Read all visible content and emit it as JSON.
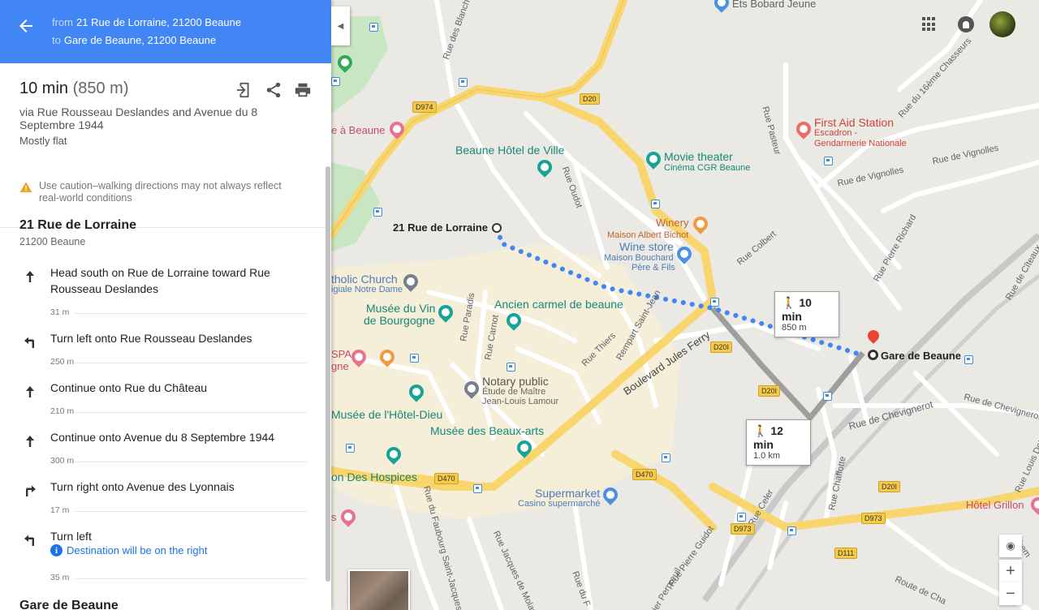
{
  "header": {
    "from_prefix": "from",
    "from_address": "21 Rue de Lorraine, 21200 Beaune",
    "to_prefix": "to",
    "to_address": "Gare de Beaune, 21200 Beaune"
  },
  "summary": {
    "time": "10 min",
    "distance": "(850 m)",
    "via": "via Rue Rousseau Deslandes and Avenue du 8 Septembre 1944",
    "terrain": "Mostly flat",
    "icons": [
      "send-to-phone-icon",
      "share-icon",
      "print-icon"
    ]
  },
  "caution": "Use caution–walking directions may not always reflect real-world conditions",
  "origin": {
    "title": "21 Rue de Lorraine",
    "subtitle": "21200 Beaune"
  },
  "steps": [
    {
      "icon": "arrow-straight-icon",
      "text": "Head south on Rue de Lorraine toward Rue Rousseau Deslandes",
      "distance": "31 m"
    },
    {
      "icon": "turn-left-icon",
      "text": "Turn left onto Rue Rousseau Deslandes",
      "distance": "250 m"
    },
    {
      "icon": "arrow-straight-icon",
      "text": "Continue onto Rue du Château",
      "distance": "210 m"
    },
    {
      "icon": "arrow-straight-icon",
      "text": "Continue onto Avenue du 8 Septembre 1944",
      "distance": "300 m"
    },
    {
      "icon": "turn-right-icon",
      "text": "Turn right onto Avenue des Lyonnais",
      "distance": "17 m"
    },
    {
      "icon": "turn-left-icon",
      "text": "Turn left",
      "info": "Destination will be on the right",
      "distance": "35 m"
    }
  ],
  "destination": {
    "title": "Gare de Beaune"
  },
  "map": {
    "labels": {
      "ets_bobard": "Ets Bobard Jeune",
      "first_aid": "First Aid Station",
      "first_aid_sub1": "Escadron -",
      "first_aid_sub2": "Gendarmerie Nationale",
      "beaune_hotel_de_ville": "Beaune Hôtel de Ville",
      "movie_theater": "Movie theater",
      "cinema": "Cinéma CGR Beaune",
      "winery": "Winery",
      "winery_sub": "Maison Albert Bichot",
      "wine_store": "Wine store",
      "wine_store_sub1": "Maison Bouchard",
      "wine_store_sub2": "Père & Fils",
      "origin_label": "21 Rue de Lorraine",
      "dest_label": "Gare de Beaune",
      "catholic_church": "tholic Church",
      "catholic_sub": "igiale Notre Dame",
      "musee_du_vin_1": "Musée du Vin",
      "musee_du_vin_2": "de Bourgogne",
      "ancien_carmel": "Ancien carmel de beaune",
      "notary": "Notary public",
      "notary_sub1": "Étude de Maître",
      "notary_sub2": "Jean-Louis Lamour",
      "musee_hotel_dieu": "Musée de l'Hôtel-Dieu",
      "musee_beaux_arts": "Musée des Beaux-arts",
      "des_hospices": "on Des Hospices",
      "supermarket": "Supermarket",
      "supermarket_sub": "Casino supermarché",
      "hotel_grillon": "Hôtel Grillon",
      "spa_1": "SPA",
      "spa_2": "gne",
      "a_beaune": "e à Beaune",
      "s_label": "s"
    },
    "streets": {
      "rue_pasteur": "Rue Pasteur",
      "rue_colbert": "Rue Colbert",
      "rue_de_vignolles": "Rue de Vignolles",
      "rue_de_vignolles2": "Rue de Vignolles",
      "rue_du_16eme": "Rue du 16ème Chasseurs",
      "rue_pierre_richard": "Rue Pierre Richard",
      "rue_de_citeaux": "Rue de Cîteaux",
      "boulevard_jules_ferry": "Boulevard Jules Ferry",
      "rue_de_chevignerot": "Rue de Chevignerot",
      "rue_de_chevignerot2": "Rue de Chevignerot",
      "rue_chaffotte": "Rue Chaffotte",
      "rue_celer": "Rue Celer",
      "rue_louis_dettling": "Rue Louis Dettling",
      "rue_pierre_guidot": "Rue Pierre Guidot",
      "rue_perpreuil": "atier Perpreuil",
      "rue_jacques_de_molay": "Rue Jacques de Molay",
      "rue_faubourg": "Rue du Faubourg Saint-Jacques",
      "rue_thiers": "Rue Thiers",
      "rempart_saint_jean": "Rempart Saint-Jean",
      "rue_carnot": "Rue Carnot",
      "rue_paradis": "Rue Paradis",
      "rue_oudot": "Rue Oudot",
      "rue_des_blanches": "Rue des Blanches",
      "route_de_chalon": "Route de Cha",
      "chemin": "Chem",
      "rue_b": "Rue du F"
    },
    "shields": [
      "D974",
      "D20",
      "D20I",
      "D20I",
      "D470",
      "D470",
      "D973",
      "D973",
      "D111",
      "D20I"
    ],
    "route_primary": {
      "time": "10 min",
      "distance": "850 m"
    },
    "route_alt": {
      "time": "12 min",
      "distance": "1.0 km"
    },
    "controls": {
      "zoom_in": "+",
      "zoom_out": "−"
    }
  }
}
